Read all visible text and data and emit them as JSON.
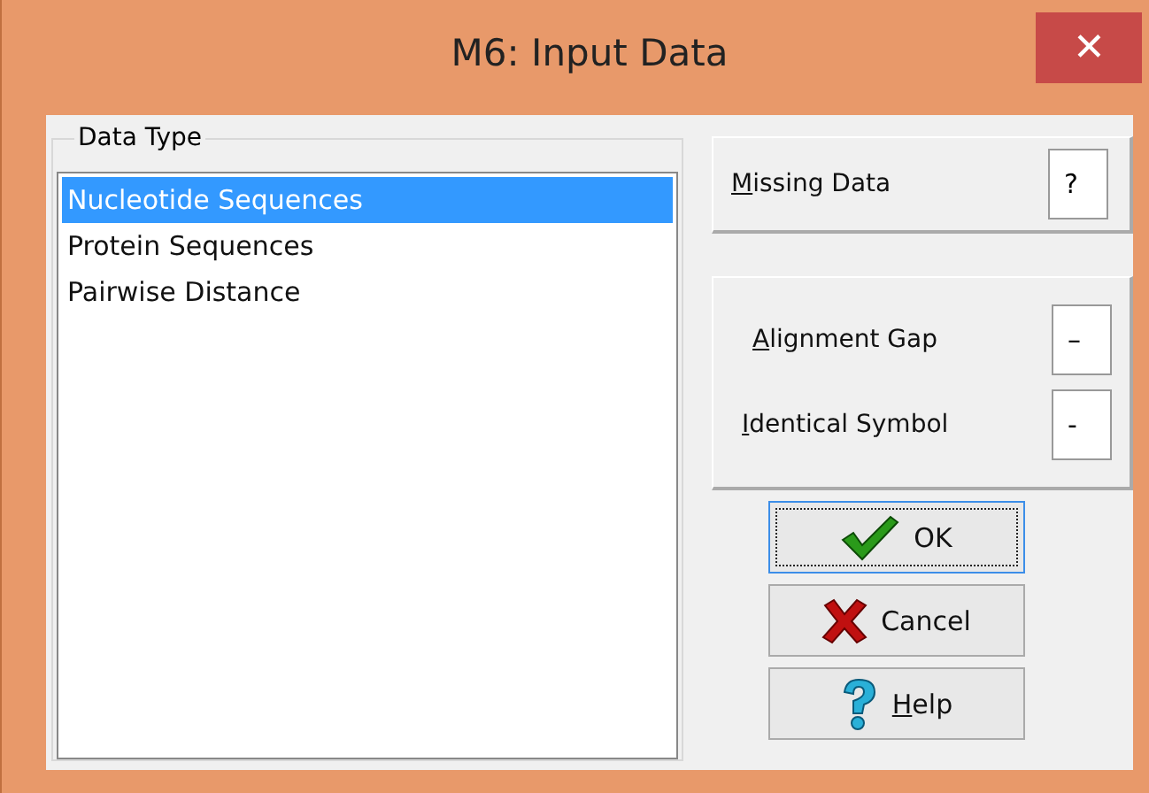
{
  "window": {
    "title": "M6: Input Data",
    "close_glyph": "✕"
  },
  "data_type": {
    "legend": "Data Type",
    "items": [
      {
        "label": "Nucleotide Sequences",
        "selected": true
      },
      {
        "label": "Protein Sequences",
        "selected": false
      },
      {
        "label": "Pairwise Distance",
        "selected": false
      }
    ]
  },
  "missing_data": {
    "label": "Missing Data",
    "mnemonic_first": true,
    "value": "?"
  },
  "symbols": [
    {
      "label": "Alignment Gap",
      "mnemonic_first": true,
      "value": "–"
    },
    {
      "label": "Identical Symbol",
      "mnemonic_first": true,
      "value": "-"
    }
  ],
  "buttons": [
    {
      "kind": "ok",
      "label": "OK",
      "mnemonic_first": false,
      "focused": true
    },
    {
      "kind": "cancel",
      "label": "Cancel",
      "mnemonic_first": false,
      "focused": false
    },
    {
      "kind": "help",
      "label": "Help",
      "mnemonic_first": true,
      "focused": false
    }
  ]
}
